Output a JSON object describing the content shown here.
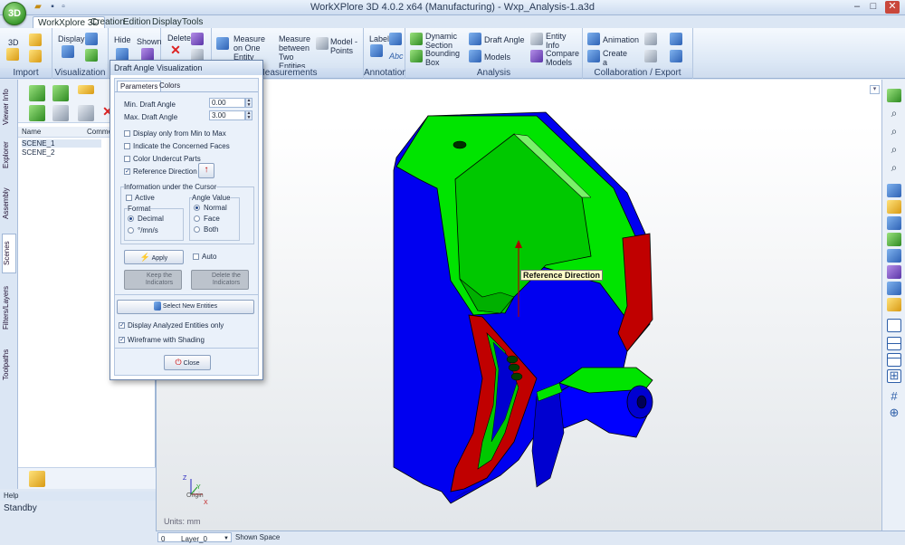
{
  "app": {
    "orb_label": "3D",
    "title": "WorkXPlore 3D 4.0.2 x64 (Manufacturing) - Wxp_Analysis-1.a3d"
  },
  "ribbon": {
    "tabs": [
      "WorkXplore 3D",
      "Creation",
      "Edition",
      "Display",
      "Tools"
    ],
    "groups": {
      "import": "Import",
      "visualization": "Visualization",
      "measurements": "Measurements",
      "annotation": "Annotation",
      "analysis": "Analysis",
      "collab": "Collaboration / Export"
    },
    "buttons": {
      "b3d": "3D",
      "display": "Display",
      "hide": "Hide",
      "shown": "Shown",
      "delete": "Delete",
      "measure_one": "Measure on One Entity",
      "measure_two": "Measure between Two Entities",
      "model_points": "Model - Points",
      "label": "Label",
      "abc": "Abc",
      "dynamic_section": "Dynamic Section",
      "bounding_box": "Bounding Box",
      "draft_angle": "Draft Angle",
      "models": "Models",
      "entity_info": "Entity Info",
      "compare_models": "Compare Models",
      "animation": "Animation",
      "create_scene": "Create a Scene"
    }
  },
  "vtabs": [
    "Viewer Info",
    "Explorer",
    "Assembly",
    "Scenes",
    "Filters/Layers",
    "Toolpaths"
  ],
  "scenes_panel": {
    "col_name": "Name",
    "col_comment": "Comment",
    "rows": [
      "SCENE_1",
      "SCENE_2"
    ]
  },
  "help": {
    "title": "Help",
    "status": "Standby"
  },
  "statusbar": {
    "index": "0",
    "layer": "Layer_0",
    "space": "Shown Space"
  },
  "viewport": {
    "units": "Units: mm",
    "annotation": "Reference Direction",
    "axes": {
      "x": "X",
      "y": "Y",
      "z": "Z",
      "origin": "Origin"
    }
  },
  "dialog": {
    "title": "Draft Angle Visualization",
    "tabs": [
      "Parameters",
      "Colors"
    ],
    "min_label": "Min. Draft Angle",
    "min_value": "0.00",
    "max_label": "Max. Draft Angle",
    "max_value": "3.00",
    "opt_display_min_max": "Display only from Min to Max",
    "opt_indicate_faces": "Indicate the Concerned Faces",
    "opt_color_undercut": "Color Undercut Parts",
    "opt_reference_direction": "Reference Direction",
    "info_title": "Information under the Cursor",
    "active": "Active",
    "format_title": "Format",
    "format_decimal": "Decimal",
    "format_dms": "°/mn/s",
    "angle_title": "Angle Value",
    "angle_normal": "Normal",
    "angle_face": "Face",
    "angle_both": "Both",
    "apply": "Apply",
    "auto": "Auto",
    "keep": "Keep the Indicators",
    "delete": "Delete the Indicators",
    "select_new": "Select New Entities",
    "display_analyzed": "Display Analyzed Entities only",
    "wireframe": "Wireframe with Shading",
    "close": "Close"
  },
  "colors": {
    "draft_ok": "#00e000",
    "draft_zero": "#0000ff",
    "undercut": "#c00000",
    "accent": "#2d5ea8"
  }
}
